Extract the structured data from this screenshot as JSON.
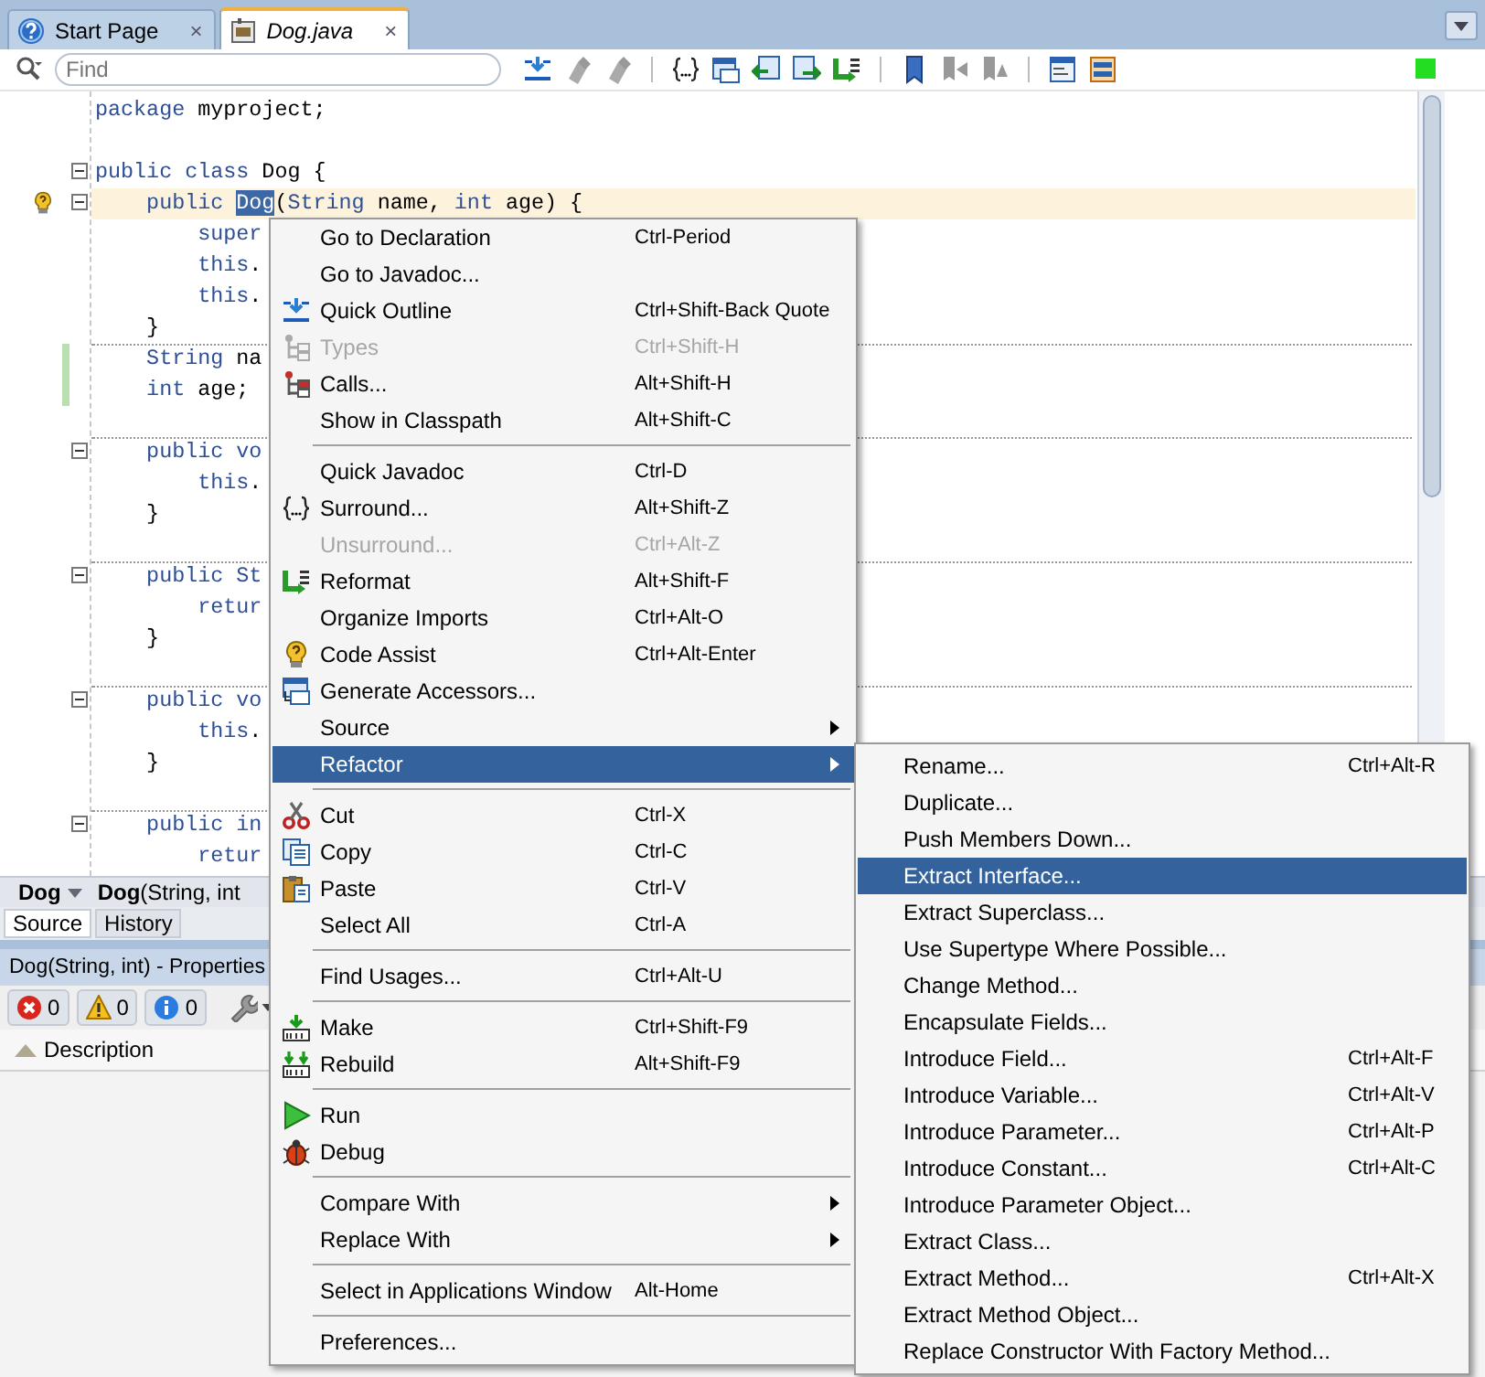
{
  "doc_tabs": [
    {
      "label": "Start Page",
      "close": "×",
      "selected": false
    },
    {
      "label": "Dog.java",
      "close": "×",
      "selected": true
    }
  ],
  "find": {
    "placeholder": "Find"
  },
  "code_lines": [
    {
      "kind": "code",
      "tokens": [
        {
          "text": "package",
          "kind": "kw"
        },
        {
          "text": " myproject;",
          "kind": "text"
        }
      ]
    },
    {
      "kind": "blank"
    },
    {
      "kind": "code",
      "fold": true,
      "tokens": [
        {
          "text": "public class",
          "kind": "kw"
        },
        {
          "text": " Dog {",
          "kind": "text"
        }
      ]
    },
    {
      "kind": "code",
      "fold": true,
      "hint": true,
      "current": true,
      "tokens": [
        {
          "text": "    public ",
          "kind": "kw"
        },
        {
          "text": "Dog",
          "kind": "sel"
        },
        {
          "text": "(",
          "kind": "text"
        },
        {
          "text": "String",
          "kind": "kw"
        },
        {
          "text": " name, ",
          "kind": "text"
        },
        {
          "text": "int",
          "kind": "kw"
        },
        {
          "text": " age) {",
          "kind": "text"
        }
      ]
    },
    {
      "kind": "code",
      "tokens": [
        {
          "text": "        super",
          "kind": "kw"
        }
      ]
    },
    {
      "kind": "code",
      "tokens": [
        {
          "text": "        this",
          "kind": "kw"
        },
        {
          "text": ".",
          "kind": "text"
        }
      ]
    },
    {
      "kind": "code",
      "tokens": [
        {
          "text": "        this",
          "kind": "kw"
        },
        {
          "text": ".",
          "kind": "text"
        }
      ]
    },
    {
      "kind": "code",
      "tokens": [
        {
          "text": "    }",
          "kind": "text"
        }
      ]
    },
    {
      "kind": "code",
      "rule_above": true,
      "added": true,
      "tokens": [
        {
          "text": "    String",
          "kind": "kw"
        },
        {
          "text": " na",
          "kind": "text"
        }
      ]
    },
    {
      "kind": "code",
      "added": true,
      "tokens": [
        {
          "text": "    int",
          "kind": "kw"
        },
        {
          "text": " age;",
          "kind": "text"
        }
      ]
    },
    {
      "kind": "blank"
    },
    {
      "kind": "code",
      "fold": true,
      "rule_above": true,
      "tokens": [
        {
          "text": "    public vo",
          "kind": "kw"
        }
      ]
    },
    {
      "kind": "code",
      "tokens": [
        {
          "text": "        this",
          "kind": "kw"
        },
        {
          "text": ".",
          "kind": "text"
        }
      ]
    },
    {
      "kind": "code",
      "tokens": [
        {
          "text": "    }",
          "kind": "text"
        }
      ]
    },
    {
      "kind": "blank"
    },
    {
      "kind": "code",
      "fold": true,
      "rule_above": true,
      "tokens": [
        {
          "text": "    public St",
          "kind": "kw"
        }
      ]
    },
    {
      "kind": "code",
      "tokens": [
        {
          "text": "        retur",
          "kind": "kw"
        }
      ]
    },
    {
      "kind": "code",
      "tokens": [
        {
          "text": "    }",
          "kind": "text"
        }
      ]
    },
    {
      "kind": "blank"
    },
    {
      "kind": "code",
      "fold": true,
      "rule_above": true,
      "tokens": [
        {
          "text": "    public vo",
          "kind": "kw"
        }
      ]
    },
    {
      "kind": "code",
      "tokens": [
        {
          "text": "        this",
          "kind": "kw"
        },
        {
          "text": ".",
          "kind": "text"
        }
      ]
    },
    {
      "kind": "code",
      "tokens": [
        {
          "text": "    }",
          "kind": "text"
        }
      ]
    },
    {
      "kind": "blank"
    },
    {
      "kind": "code",
      "fold": true,
      "rule_above": true,
      "tokens": [
        {
          "text": "    public in",
          "kind": "kw"
        }
      ]
    },
    {
      "kind": "code",
      "tokens": [
        {
          "text": "        retur",
          "kind": "kw"
        }
      ]
    }
  ],
  "breadcrumb": [
    {
      "text": "Dog",
      "kind": "class",
      "dropdown": true
    },
    {
      "text": "**Dog**(String, int",
      "kind": "member"
    }
  ],
  "editor_tabs": [
    {
      "label": "Source",
      "selected": true
    },
    {
      "label": "History",
      "selected": false
    }
  ],
  "properties": {
    "title": "Dog(String, int) - Properties",
    "counters": [
      {
        "kind": "error",
        "count": "0"
      },
      {
        "kind": "warning",
        "count": "0"
      },
      {
        "kind": "info",
        "count": "0"
      }
    ],
    "columns": [
      "Description"
    ]
  },
  "context_menu": {
    "items": [
      {
        "kind": "item",
        "label": "Go to Declaration",
        "shortcut": "Ctrl-Period"
      },
      {
        "kind": "item",
        "label": "Go to Javadoc..."
      },
      {
        "kind": "item",
        "label": "Quick Outline",
        "shortcut": "Ctrl+Shift-Back Quote"
      },
      {
        "kind": "item",
        "label": "Types",
        "shortcut": "Ctrl+Shift-H",
        "disabled": true
      },
      {
        "kind": "item",
        "label": "Calls...",
        "shortcut": "Alt+Shift-H"
      },
      {
        "kind": "item",
        "label": "Show in Classpath",
        "shortcut": "Alt+Shift-C"
      },
      {
        "kind": "separator"
      },
      {
        "kind": "item",
        "label": "Quick Javadoc",
        "shortcut": "Ctrl-D"
      },
      {
        "kind": "item",
        "label": "Surround...",
        "shortcut": "Alt+Shift-Z"
      },
      {
        "kind": "item",
        "label": "Unsurround...",
        "shortcut": "Ctrl+Alt-Z",
        "disabled": true
      },
      {
        "kind": "item",
        "label": "Reformat",
        "shortcut": "Alt+Shift-F"
      },
      {
        "kind": "item",
        "label": "Organize Imports",
        "shortcut": "Ctrl+Alt-O"
      },
      {
        "kind": "item",
        "label": "Code Assist",
        "shortcut": "Ctrl+Alt-Enter"
      },
      {
        "kind": "item",
        "label": "Generate Accessors..."
      },
      {
        "kind": "item",
        "label": "Source",
        "submenu": true
      },
      {
        "kind": "item",
        "label": "Refactor",
        "submenu": true,
        "selected": true
      },
      {
        "kind": "separator"
      },
      {
        "kind": "item",
        "label": "Cut",
        "shortcut": "Ctrl-X"
      },
      {
        "kind": "item",
        "label": "Copy",
        "shortcut": "Ctrl-C"
      },
      {
        "kind": "item",
        "label": "Paste",
        "shortcut": "Ctrl-V"
      },
      {
        "kind": "item",
        "label": "Select All",
        "shortcut": "Ctrl-A"
      },
      {
        "kind": "separator"
      },
      {
        "kind": "item",
        "label": "Find Usages...",
        "shortcut": "Ctrl+Alt-U"
      },
      {
        "kind": "separator"
      },
      {
        "kind": "item",
        "label": "Make",
        "shortcut": "Ctrl+Shift-F9"
      },
      {
        "kind": "item",
        "label": "Rebuild",
        "shortcut": "Alt+Shift-F9"
      },
      {
        "kind": "separator"
      },
      {
        "kind": "item",
        "label": "Run"
      },
      {
        "kind": "item",
        "label": "Debug"
      },
      {
        "kind": "separator"
      },
      {
        "kind": "item",
        "label": "Compare With",
        "submenu": true
      },
      {
        "kind": "item",
        "label": "Replace With",
        "submenu": true
      },
      {
        "kind": "separator"
      },
      {
        "kind": "item",
        "label": "Select in Applications Window",
        "shortcut": "Alt-Home"
      },
      {
        "kind": "separator"
      },
      {
        "kind": "item",
        "label": "Preferences..."
      }
    ]
  },
  "submenu": {
    "items": [
      {
        "label": "Rename...",
        "shortcut": "Ctrl+Alt-R",
        "selected": false
      },
      {
        "label": "Duplicate...",
        "selected": false
      },
      {
        "label": "Push Members Down...",
        "selected": false
      },
      {
        "label": "Extract Interface...",
        "selected": true
      },
      {
        "label": "Extract Superclass...",
        "selected": false
      },
      {
        "label": "Use Supertype Where Possible...",
        "selected": false
      },
      {
        "label": "Change Method...",
        "selected": false
      },
      {
        "label": "Encapsulate Fields...",
        "selected": false
      },
      {
        "label": "Introduce Field...",
        "shortcut": "Ctrl+Alt-F",
        "selected": false
      },
      {
        "label": "Introduce Variable...",
        "shortcut": "Ctrl+Alt-V",
        "selected": false
      },
      {
        "label": "Introduce Parameter...",
        "shortcut": "Ctrl+Alt-P",
        "selected": false
      },
      {
        "label": "Introduce Constant...",
        "shortcut": "Ctrl+Alt-C",
        "selected": false
      },
      {
        "label": "Introduce Parameter Object...",
        "selected": false
      },
      {
        "label": "Extract Class...",
        "selected": false
      },
      {
        "label": "Extract Method...",
        "shortcut": "Ctrl+Alt-X",
        "selected": false
      },
      {
        "label": "Extract Method Object...",
        "selected": false
      },
      {
        "label": "Replace Constructor With Factory Method...",
        "selected": false
      }
    ]
  }
}
